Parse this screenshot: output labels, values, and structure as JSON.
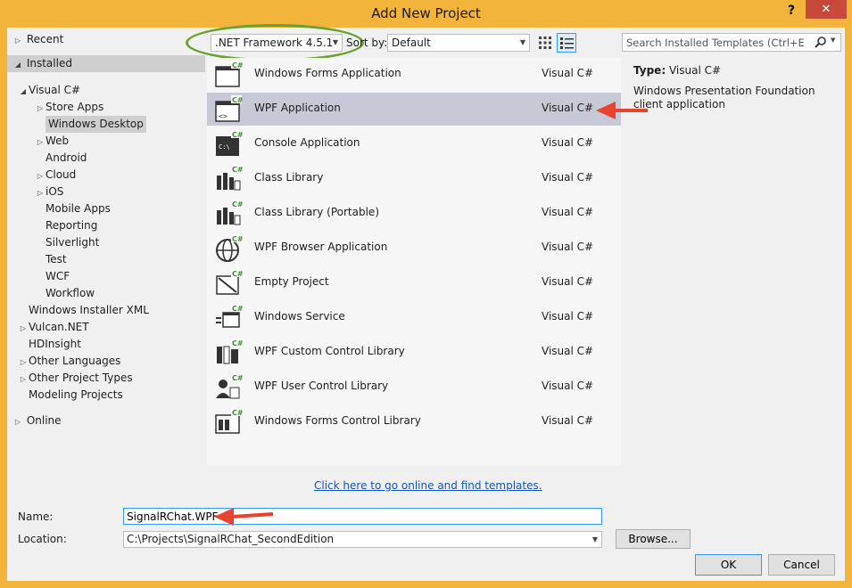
{
  "window": {
    "title": "Add New Project",
    "help_label": "?",
    "close_label": "✕"
  },
  "tree": {
    "recent": "Recent",
    "installed": "Installed",
    "items": [
      {
        "label": "Visual C#",
        "level": 1,
        "expander": "open"
      },
      {
        "label": "Store Apps",
        "level": 2,
        "expander": "closed"
      },
      {
        "label": "Windows Desktop",
        "level": 2,
        "expander": "none",
        "selected": true
      },
      {
        "label": "Web",
        "level": 2,
        "expander": "closed"
      },
      {
        "label": "Android",
        "level": 2,
        "expander": "none"
      },
      {
        "label": "Cloud",
        "level": 2,
        "expander": "closed"
      },
      {
        "label": "iOS",
        "level": 2,
        "expander": "closed"
      },
      {
        "label": "Mobile Apps",
        "level": 2,
        "expander": "none"
      },
      {
        "label": "Reporting",
        "level": 2,
        "expander": "none"
      },
      {
        "label": "Silverlight",
        "level": 2,
        "expander": "none"
      },
      {
        "label": "Test",
        "level": 2,
        "expander": "none"
      },
      {
        "label": "WCF",
        "level": 2,
        "expander": "none"
      },
      {
        "label": "Workflow",
        "level": 2,
        "expander": "none"
      },
      {
        "label": "Windows Installer XML",
        "level": 1,
        "expander": "none"
      },
      {
        "label": "Vulcan.NET",
        "level": 1,
        "expander": "closed"
      },
      {
        "label": "HDInsight",
        "level": 1,
        "expander": "none"
      },
      {
        "label": "Other Languages",
        "level": 1,
        "expander": "closed"
      },
      {
        "label": "Other Project Types",
        "level": 1,
        "expander": "closed"
      },
      {
        "label": "Modeling Projects",
        "level": 1,
        "expander": "none"
      }
    ],
    "online": "Online"
  },
  "toolbar": {
    "framework": ".NET Framework 4.5.1",
    "sort_by_label": "Sort by:",
    "sort_value": "Default",
    "search_placeholder": "Search Installed Templates (Ctrl+E)"
  },
  "templates": [
    {
      "name": "Windows Forms Application",
      "lang": "Visual C#",
      "icon": "window-icon"
    },
    {
      "name": "WPF Application",
      "lang": "Visual C#",
      "icon": "wpf-window-icon",
      "selected": true
    },
    {
      "name": "Console Application",
      "lang": "Visual C#",
      "icon": "console-icon"
    },
    {
      "name": "Class Library",
      "lang": "Visual C#",
      "icon": "class-library-icon"
    },
    {
      "name": "Class Library (Portable)",
      "lang": "Visual C#",
      "icon": "portable-library-icon"
    },
    {
      "name": "WPF Browser Application",
      "lang": "Visual C#",
      "icon": "globe-icon"
    },
    {
      "name": "Empty Project",
      "lang": "Visual C#",
      "icon": "empty-project-icon"
    },
    {
      "name": "Windows Service",
      "lang": "Visual C#",
      "icon": "service-icon"
    },
    {
      "name": "WPF Custom Control Library",
      "lang": "Visual C#",
      "icon": "custom-control-icon"
    },
    {
      "name": "WPF User Control Library",
      "lang": "Visual C#",
      "icon": "user-control-icon"
    },
    {
      "name": "Windows Forms Control Library",
      "lang": "Visual C#",
      "icon": "forms-control-icon"
    }
  ],
  "online_link": "Click here to go online and find templates.",
  "details": {
    "type_label": "Type:",
    "type_value": "Visual C#",
    "description": "Windows Presentation Foundation client application"
  },
  "form": {
    "name_label": "Name:",
    "name_value": "SignalRChat.WPF",
    "location_label": "Location:",
    "location_value": "C:\\Projects\\SignalRChat_SecondEdition",
    "browse_label": "Browse...",
    "ok_label": "OK",
    "cancel_label": "Cancel"
  },
  "colors": {
    "accent": "#3399ff",
    "title_bar": "#f2b43b",
    "close": "#c7493a",
    "annotation_arrow": "#e8432e",
    "annotation_ellipse": "#6aa232"
  }
}
